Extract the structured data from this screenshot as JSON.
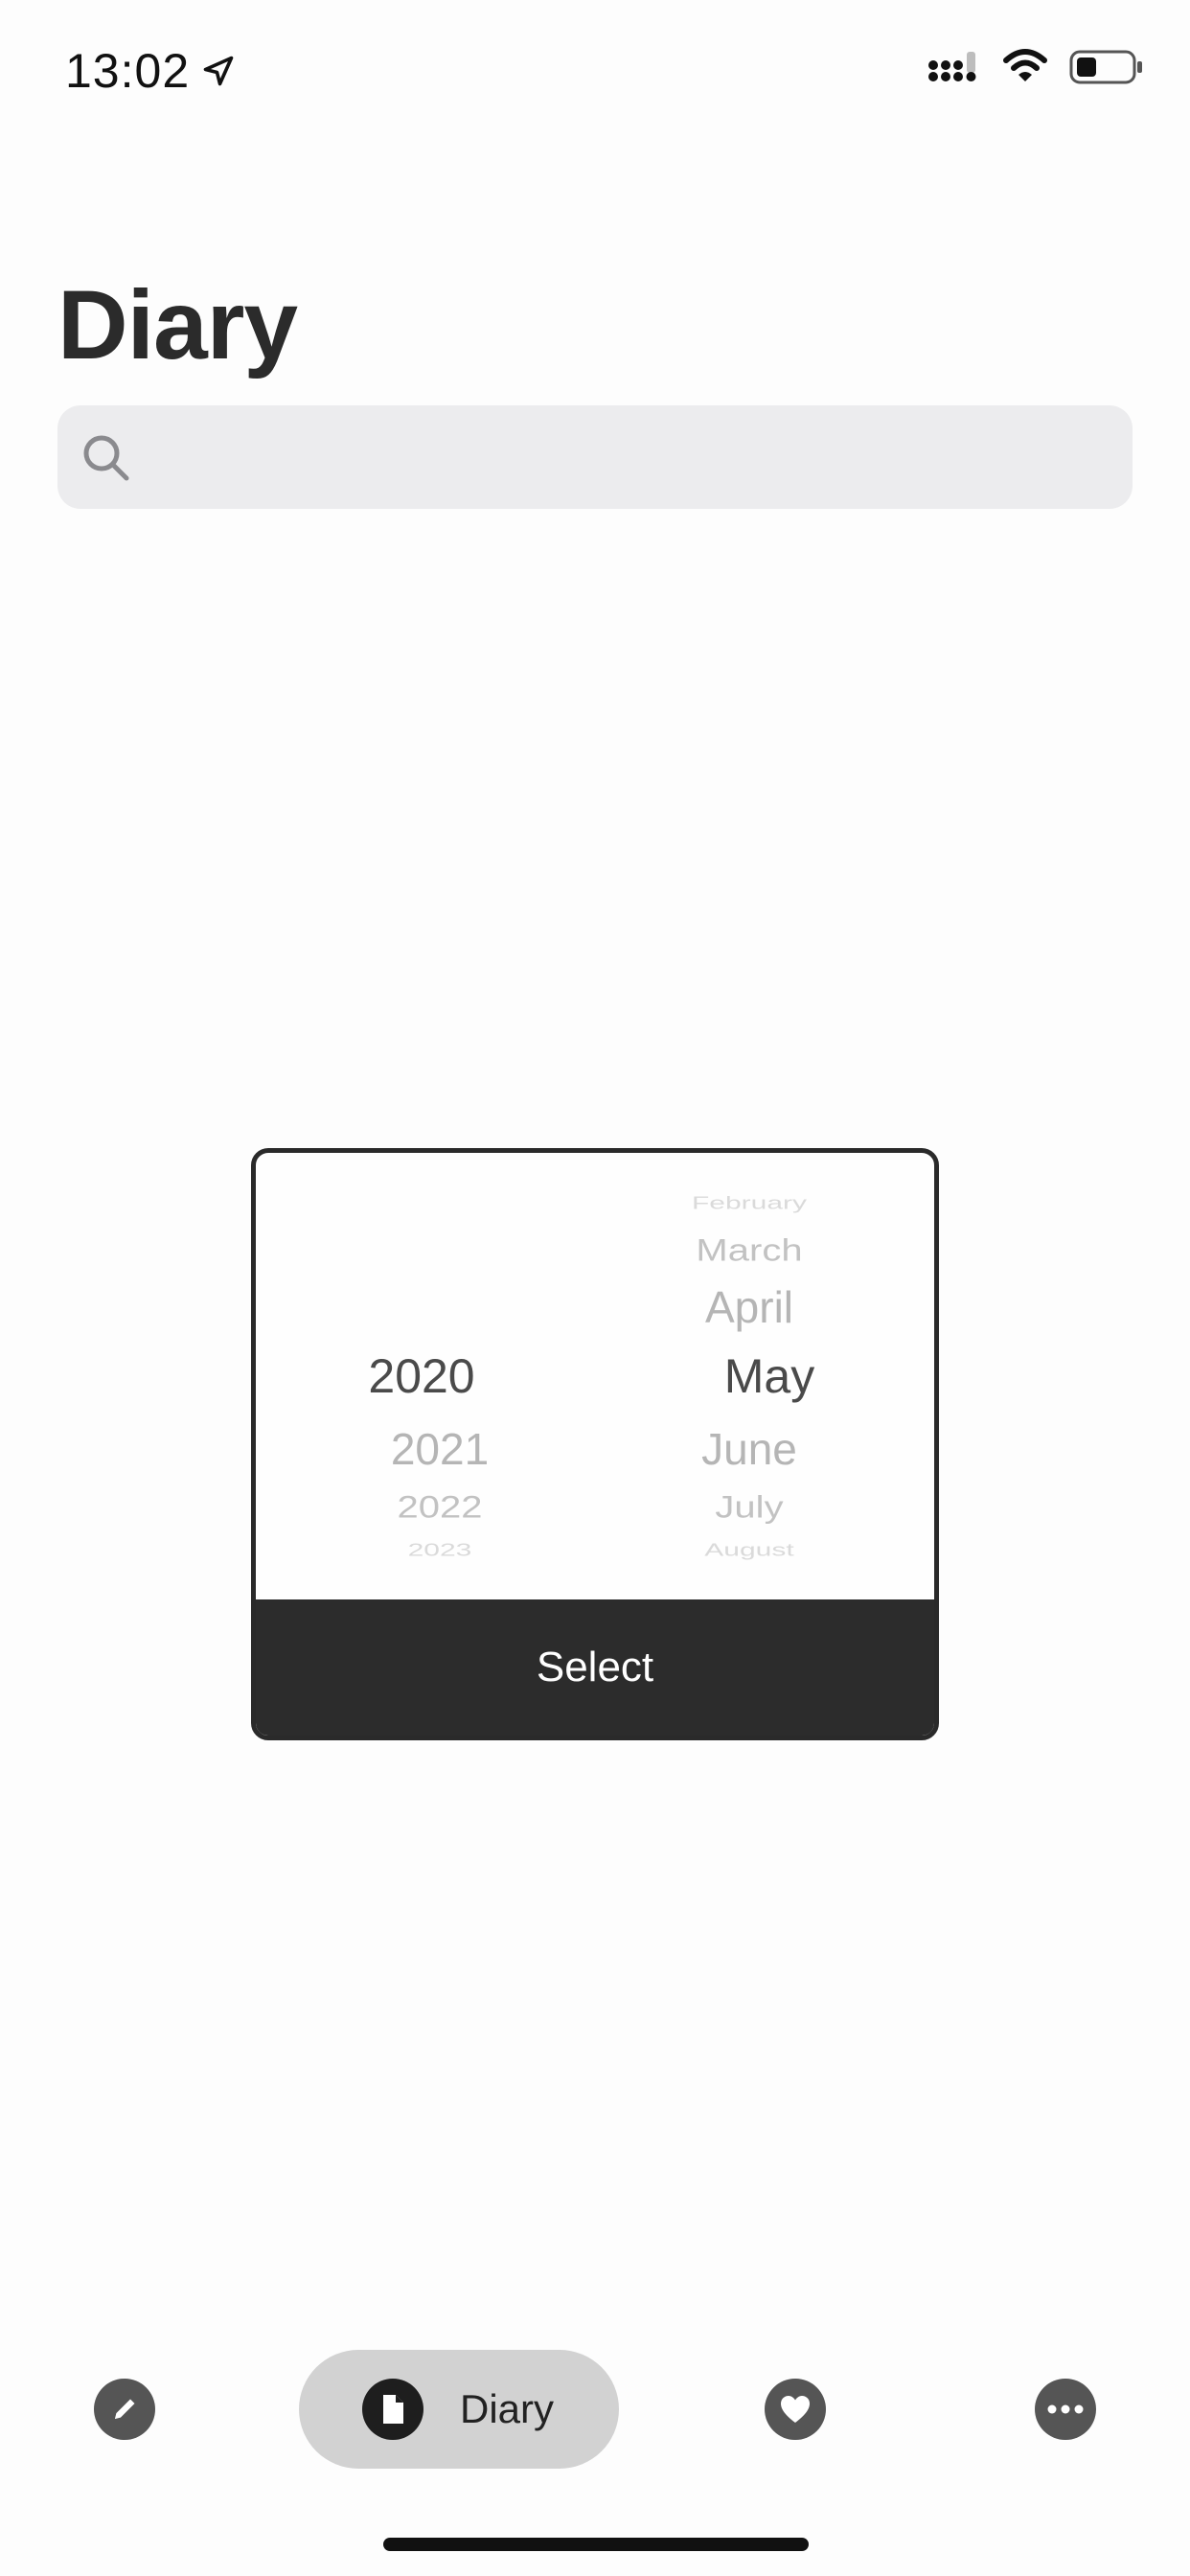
{
  "status_bar": {
    "time": "13:02",
    "icons": [
      "location-arrow-icon",
      "cellular-signal-icon",
      "wifi-icon",
      "battery-icon"
    ]
  },
  "header": {
    "title": "Diary"
  },
  "search": {
    "placeholder": "",
    "value": ""
  },
  "picker": {
    "year_column": [
      "2020",
      "2021",
      "2022",
      "2023"
    ],
    "selected_year": "2020",
    "month_column": [
      "February",
      "March",
      "April",
      "May",
      "June",
      "July",
      "August"
    ],
    "selected_month": "May",
    "select_label": "Select"
  },
  "tab_bar": {
    "items": [
      {
        "icon": "pencil-icon",
        "label": ""
      },
      {
        "icon": "document-icon",
        "label": "Diary",
        "active": true
      },
      {
        "icon": "heart-icon",
        "label": ""
      },
      {
        "icon": "more-icon",
        "label": ""
      }
    ]
  },
  "colors": {
    "accent_dark": "#2c2c2c",
    "active_tab_bg": "#d2d2d2",
    "search_bg": "#ececee"
  }
}
